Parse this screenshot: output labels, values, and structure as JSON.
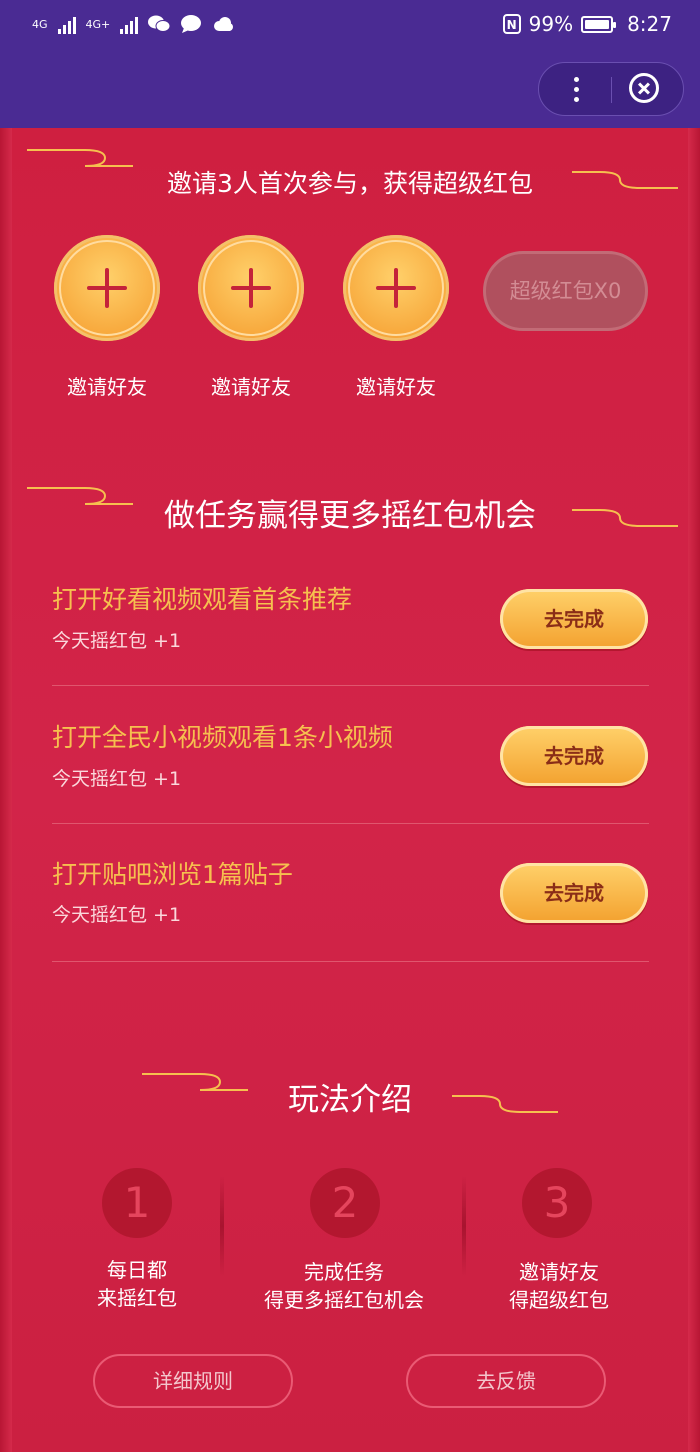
{
  "status_bar": {
    "network_1": "4G",
    "network_2": "4G+",
    "battery_percent": "99%",
    "battery_level": 0.99,
    "time": "8:27",
    "nfc": "N",
    "icons": [
      "signal-icon",
      "wechat-icon",
      "message-icon",
      "cloud-icon",
      "nfc-icon",
      "battery-icon"
    ]
  },
  "title_bar": {
    "more_icon": "more-dots-icon",
    "close_icon": "close-circle-icon"
  },
  "invite_section": {
    "title": "邀请3人首次参与，获得超级红包",
    "slots": [
      {
        "label": "邀请好友",
        "icon": "plus-icon"
      },
      {
        "label": "邀请好友",
        "icon": "plus-icon"
      },
      {
        "label": "邀请好友",
        "icon": "plus-icon"
      }
    ],
    "super_button": "超级红包X0"
  },
  "task_section": {
    "title": "做任务赢得更多摇红包机会",
    "tasks": [
      {
        "title": "打开好看视频观看首条推荐",
        "subtitle": "今天摇红包 +1",
        "button": "去完成"
      },
      {
        "title": "打开全民小视频观看1条小视频",
        "subtitle": "今天摇红包 +1",
        "button": "去完成"
      },
      {
        "title": "打开贴吧浏览1篇贴子",
        "subtitle": "今天摇红包 +1",
        "button": "去完成"
      }
    ]
  },
  "rules_section": {
    "title": "玩法介绍",
    "steps": [
      {
        "number": "1",
        "line1": "每日都",
        "line2": "来摇红包"
      },
      {
        "number": "2",
        "line1": "完成任务",
        "line2": "得更多摇红包机会"
      },
      {
        "number": "3",
        "line1": "邀请好友",
        "line2": "得超级红包"
      }
    ],
    "rules_button": "详细规则",
    "feedback_button": "去反馈"
  },
  "colors": {
    "status_bg": "#4a2b93",
    "page_bg": "#d02244",
    "gold_text": "#f6c04f",
    "button_gold": "#f7a83c"
  }
}
